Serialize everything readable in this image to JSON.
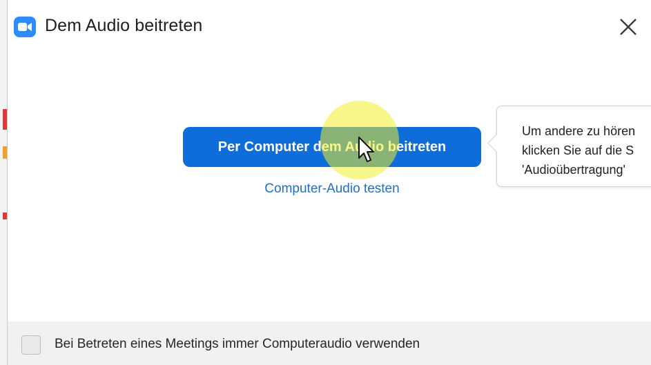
{
  "window": {
    "title": "Dem Audio beitreten",
    "app_icon": "zoom-camera-icon",
    "close_icon": "close-icon"
  },
  "main": {
    "join_button_label": "Per Computer dem Audio beitreten",
    "test_link_label": "Computer-Audio testen"
  },
  "tooltip": {
    "lines": [
      "Um andere zu hören",
      "klicken Sie auf die S",
      "'Audioübertragung'"
    ]
  },
  "footer": {
    "checkbox_label": "Bei Betreten eines Meetings immer Computeraudio verwenden",
    "checked": false
  },
  "colors": {
    "accent": "#0e6dd8",
    "link": "#1f6fca",
    "app_icon": "#2d8cff",
    "cursor_highlight": "#f0ee28"
  }
}
